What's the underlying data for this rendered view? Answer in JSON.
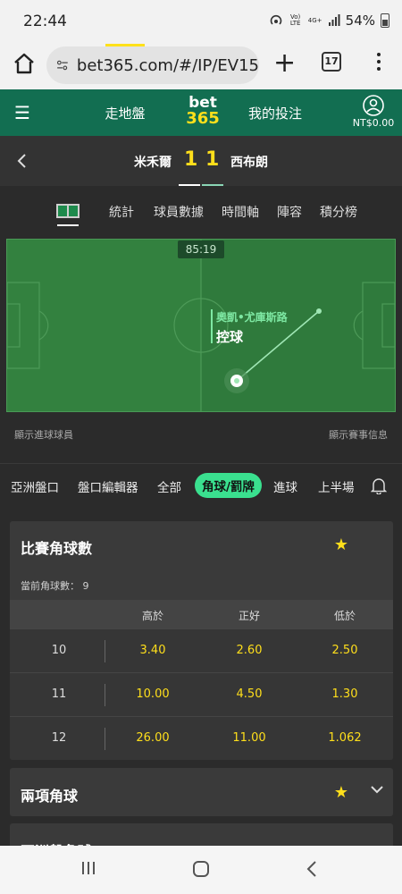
{
  "status_bar": {
    "time": "22:44",
    "volte": "Vo) LTE",
    "network": "4G+",
    "battery_pct": "54%"
  },
  "browser": {
    "url": "bet365.com/#/IP/EV15",
    "tab_count": "17"
  },
  "header": {
    "inplay": "走地盤",
    "logo_top": "bet",
    "logo_bottom": "365",
    "my_bets": "我的投注",
    "balance": "NT$0.00"
  },
  "match": {
    "team_home": "米禾爾",
    "score_home": "1",
    "score_away": "1",
    "team_away": "西布朗"
  },
  "match_tabs": [
    "統計",
    "球員數據",
    "時間軸",
    "陣容",
    "積分榜"
  ],
  "pitch": {
    "clock": "85:19",
    "player": "奧凱•尤庫斯路",
    "status": "控球",
    "show_scorers": "顯示進球球員",
    "show_info": "顯示賽事信息"
  },
  "filters": [
    "亞洲盤口",
    "盤口編輯器",
    "全部",
    "角球/罰牌",
    "進球",
    "上半場"
  ],
  "filters_active_index": 3,
  "market": {
    "title": "比賽角球數",
    "current_label": "當前角球數：  9",
    "columns": [
      "高於",
      "正好",
      "低於"
    ],
    "rows": [
      {
        "line": "10",
        "over": "3.40",
        "exact": "2.60",
        "under": "2.50"
      },
      {
        "line": "11",
        "over": "10.00",
        "exact": "4.50",
        "under": "1.30"
      },
      {
        "line": "12",
        "over": "26.00",
        "exact": "11.00",
        "under": "1.062"
      }
    ]
  },
  "market2": {
    "title": "兩項角球"
  },
  "market3": {
    "title": "亞洲盤角球"
  },
  "colors": {
    "brand_green": "#126e51",
    "accent_yellow": "#ffdf1b",
    "active_filter": "#3ae08f",
    "pitch_green": "#2f7a3c"
  }
}
